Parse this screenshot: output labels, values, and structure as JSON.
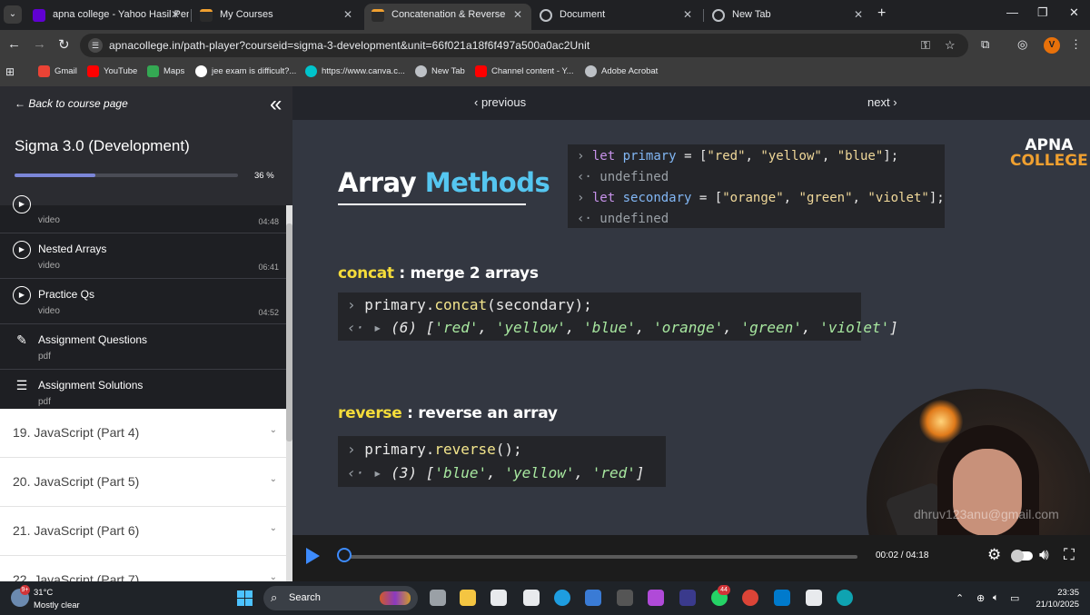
{
  "browser": {
    "tabs": [
      {
        "title": "apna college - Yahoo Hasil Pen",
        "favicon_color": "#6001d2"
      },
      {
        "title": "My Courses",
        "favicon_color": "#2b2b2b"
      },
      {
        "title": "Concatenation & Reverse",
        "favicon_color": "#2b2b2b"
      },
      {
        "title": "Document",
        "favicon_color": "#8ab4f8"
      },
      {
        "title": "New Tab",
        "favicon_color": "#8ab4f8"
      }
    ],
    "active_tab": 2,
    "url": "apnacollege.in/path-player?courseid=sigma-3-development&unit=66f021a18f6f497a500a0ac2Unit",
    "profile_initial": "V",
    "bookmarks": [
      {
        "label": "Gmail",
        "color": "#ea4335"
      },
      {
        "label": "YouTube",
        "color": "#ff0000"
      },
      {
        "label": "Maps",
        "color": "#34a853"
      },
      {
        "label": "jee exam is difficult?...",
        "color": "#ffffff"
      },
      {
        "label": "https://www.canva.c...",
        "color": "#00c4cc"
      },
      {
        "label": "New Tab",
        "color": "#bdc1c6"
      },
      {
        "label": "Channel content - Y...",
        "color": "#ff0000"
      },
      {
        "label": "Adobe Acrobat",
        "color": "#bdc1c6"
      }
    ]
  },
  "sidebar": {
    "back_link": "Back to course page",
    "course_title": "Sigma 3.0 (Development)",
    "progress_percent": 36,
    "progress_text": "36 %",
    "lessons": [
      {
        "title": "",
        "type": "video",
        "duration": "04:48",
        "icon": "play-circle-icon"
      },
      {
        "title": "Nested Arrays",
        "type": "video",
        "duration": "06:41",
        "icon": "play-circle-icon"
      },
      {
        "title": "Practice Qs",
        "type": "video",
        "duration": "04:52",
        "icon": "play-circle-icon"
      },
      {
        "title": "Assignment Questions",
        "type": "pdf",
        "duration": "",
        "icon": "document-edit-icon"
      },
      {
        "title": "Assignment Solutions",
        "type": "pdf",
        "duration": "",
        "icon": "checklist-icon"
      }
    ],
    "sections": [
      {
        "title": "19. JavaScript (Part 4)"
      },
      {
        "title": "20. JavaScript (Part 5)"
      },
      {
        "title": "21. JavaScript (Part 6)"
      },
      {
        "title": "22. JavaScript (Part 7)"
      }
    ]
  },
  "player": {
    "prev_label": "previous",
    "next_label": "next",
    "time": "00:02 / 04:18",
    "played_fraction": 0.008,
    "watermark": "dhruv123anu@gmail.com"
  },
  "slide": {
    "title_part1": "Array",
    "title_part2": "Methods",
    "logo_line1": "APNA",
    "logo_line2": "COLLEGE",
    "console_top": [
      {
        "prompt": ">",
        "code": "let primary = [\"red\", \"yellow\", \"blue\"];"
      },
      {
        "prompt": "<·",
        "code": "undefined"
      },
      {
        "prompt": ">",
        "code": "let secondary = [\"orange\", \"green\", \"violet\"];"
      },
      {
        "prompt": "<·",
        "code": "undefined"
      }
    ],
    "concat_heading_kw": "concat",
    "concat_heading_rest": " : merge 2 arrays",
    "concat_call": "primary.concat(secondary);",
    "concat_result": "(6) ['red', 'yellow', 'blue', 'orange', 'green', 'violet']",
    "reverse_heading_kw": "reverse",
    "reverse_heading_rest": " : reverse an array",
    "reverse_call": "primary.reverse();",
    "reverse_result": "(3) ['blue', 'yellow', 'red']"
  },
  "taskbar": {
    "temperature": "31°C",
    "weather": "Mostly clear",
    "weather_badge": "9+",
    "search_label": "Search",
    "whatsapp_badge": "44",
    "time": "23:35",
    "date": "21/10/2025"
  }
}
